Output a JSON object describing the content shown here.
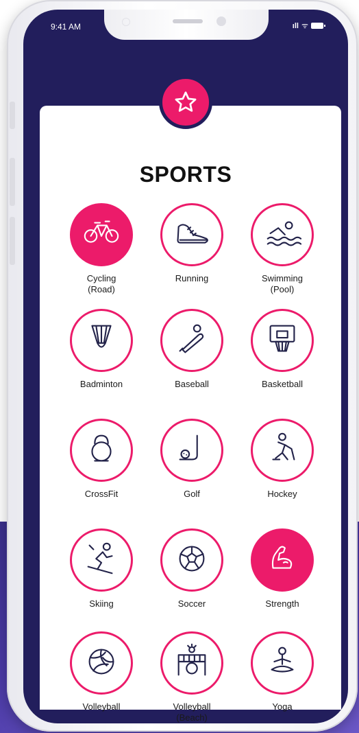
{
  "status_bar": {
    "time": "9:41 AM",
    "signal": "ıll",
    "wifi": "ᯤ"
  },
  "page": {
    "title": "SPORTS"
  },
  "colors": {
    "accent": "#ec1b6a",
    "header_bg": "#221e5c",
    "backdrop": "#4b3aa6"
  },
  "sports": [
    {
      "label": "Cycling\n(Road)",
      "icon": "bicycle-icon",
      "selected": true
    },
    {
      "label": "Running",
      "icon": "running-shoe-icon",
      "selected": false
    },
    {
      "label": "Swimming\n(Pool)",
      "icon": "swimmer-icon",
      "selected": false
    },
    {
      "label": "Badminton",
      "icon": "shuttlecock-icon",
      "selected": false
    },
    {
      "label": "Baseball",
      "icon": "baseball-bat-icon",
      "selected": false
    },
    {
      "label": "Basketball",
      "icon": "basketball-hoop-icon",
      "selected": false
    },
    {
      "label": "CrossFit",
      "icon": "kettlebell-icon",
      "selected": false
    },
    {
      "label": "Golf",
      "icon": "golf-club-icon",
      "selected": false
    },
    {
      "label": "Hockey",
      "icon": "hockey-player-icon",
      "selected": false
    },
    {
      "label": "Skiing",
      "icon": "skier-icon",
      "selected": false
    },
    {
      "label": "Soccer",
      "icon": "soccer-ball-icon",
      "selected": false
    },
    {
      "label": "Strength",
      "icon": "flexed-arm-icon",
      "selected": true
    },
    {
      "label": "Volleyball",
      "icon": "volleyball-icon",
      "selected": false
    },
    {
      "label": "Volleyball\n(Beach)",
      "icon": "beach-volleyball-icon",
      "selected": false
    },
    {
      "label": "Yoga",
      "icon": "yoga-icon",
      "selected": false
    }
  ]
}
